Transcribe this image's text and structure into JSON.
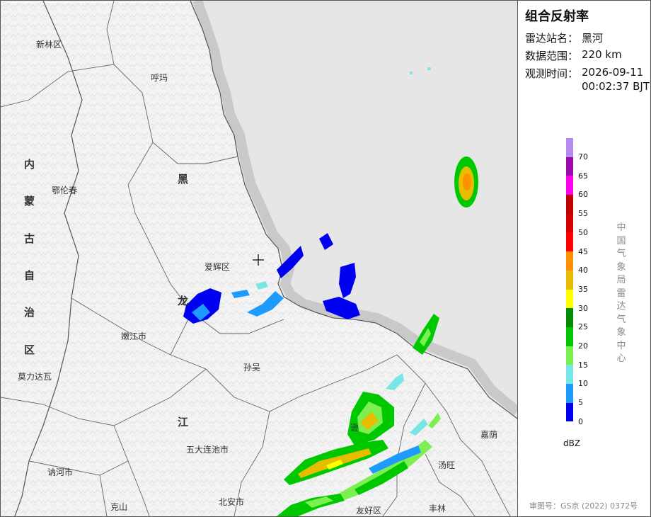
{
  "map": {
    "places": [
      {
        "id": "xinlin",
        "name": "新林区"
      },
      {
        "id": "huma",
        "name": "呼玛"
      },
      {
        "id": "elunchun",
        "name": "鄂伦春"
      },
      {
        "id": "aihui",
        "name": "爱辉区"
      },
      {
        "id": "nenjiang",
        "name": "嫩江市"
      },
      {
        "id": "sunwu",
        "name": "孙吴"
      },
      {
        "id": "molidawa",
        "name": "莫力达瓦"
      },
      {
        "id": "wudalianchi",
        "name": "五大连池市"
      },
      {
        "id": "nehe",
        "name": "讷河市"
      },
      {
        "id": "keshan",
        "name": "克山"
      },
      {
        "id": "beian",
        "name": "北安市"
      },
      {
        "id": "youhao",
        "name": "友好区"
      },
      {
        "id": "fenglin",
        "name": "丰林"
      },
      {
        "id": "tangwang",
        "name": "汤旺"
      },
      {
        "id": "jiayin",
        "name": "嘉荫"
      },
      {
        "id": "xunke",
        "name": "逊"
      }
    ],
    "province_chars": {
      "neimenggu": [
        "内",
        "蒙",
        "古",
        "自",
        "治",
        "区"
      ],
      "heilongjiang": [
        "黑",
        "龙",
        "江"
      ]
    },
    "radar_site_marker": "crosshair-icon"
  },
  "panel": {
    "title": "组合反射率",
    "info": [
      {
        "label": "雷达站名：",
        "value": "黑河"
      },
      {
        "label": "数据范围：",
        "value": "220 km"
      },
      {
        "label": "观测时间：",
        "value": "2026-09-11"
      },
      {
        "label": "",
        "value": "00:02:37 BJT"
      }
    ],
    "legend": {
      "unit": "dBZ",
      "levels": [
        {
          "value": "70",
          "color": "#b48cee"
        },
        {
          "value": "65",
          "color": "#9a0aa8"
        },
        {
          "value": "60",
          "color": "#ff00f0"
        },
        {
          "value": "55",
          "color": "#c00000"
        },
        {
          "value": "50",
          "color": "#d60000"
        },
        {
          "value": "45",
          "color": "#ff0000"
        },
        {
          "value": "40",
          "color": "#ff9000"
        },
        {
          "value": "35",
          "color": "#e8bc00"
        },
        {
          "value": "30",
          "color": "#ffff00"
        },
        {
          "value": "25",
          "color": "#008c00"
        },
        {
          "value": "20",
          "color": "#00c800"
        },
        {
          "value": "15",
          "color": "#7cf050"
        },
        {
          "value": "10",
          "color": "#78e6e6"
        },
        {
          "value": "5",
          "color": "#1e9bff"
        },
        {
          "value": "0",
          "color": "#0000f0"
        }
      ]
    },
    "center_name": [
      "中",
      "国",
      "气",
      "象",
      "局",
      "雷",
      "达",
      "气",
      "象",
      "中",
      "心"
    ],
    "approval": "审图号：GS京 (2022) 0372号"
  },
  "colors": {
    "foreign_area": "#e6e6e6",
    "border_band": "#c8c8c8",
    "terrain": "#f4f4f4",
    "boundary": "#555555"
  }
}
